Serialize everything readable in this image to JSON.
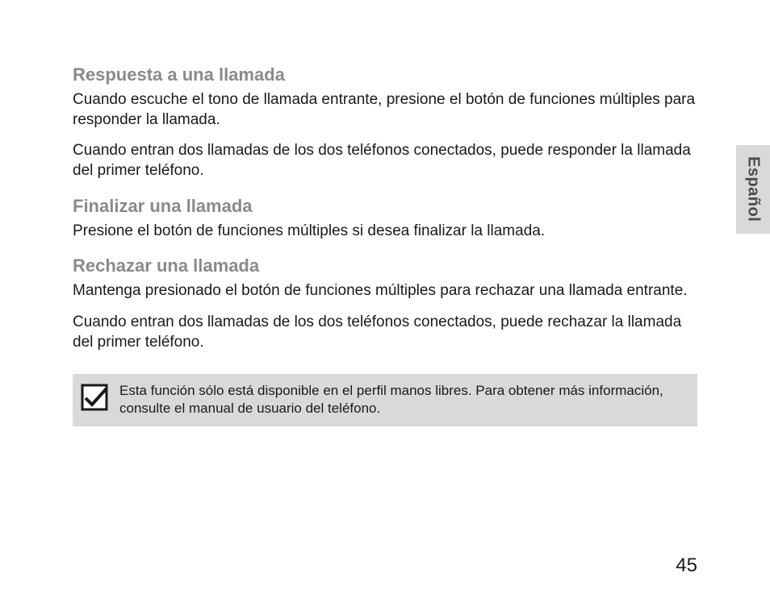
{
  "sideTab": "Español",
  "sections": {
    "s1": {
      "title": "Respuesta a una llamada",
      "p1": "Cuando escuche el tono de llamada entrante, presione el botón de funciones múltiples para responder la llamada.",
      "p2": "Cuando entran dos llamadas de los dos teléfonos conectados, puede responder la llamada del primer teléfono."
    },
    "s2": {
      "title": "Finalizar una llamada",
      "p1": "Presione el botón de funciones múltiples si desea finalizar la llamada."
    },
    "s3": {
      "title": "Rechazar una llamada",
      "p1": "Mantenga presionado el botón de funciones múltiples para rechazar una llamada entrante.",
      "p2": "Cuando entran dos llamadas de los dos teléfonos conectados, puede rechazar la llamada del primer teléfono."
    }
  },
  "note": "Esta función sólo está disponible en el perfil manos libres. Para obtener más información, consulte el manual de usuario del teléfono.",
  "pageNumber": "45"
}
